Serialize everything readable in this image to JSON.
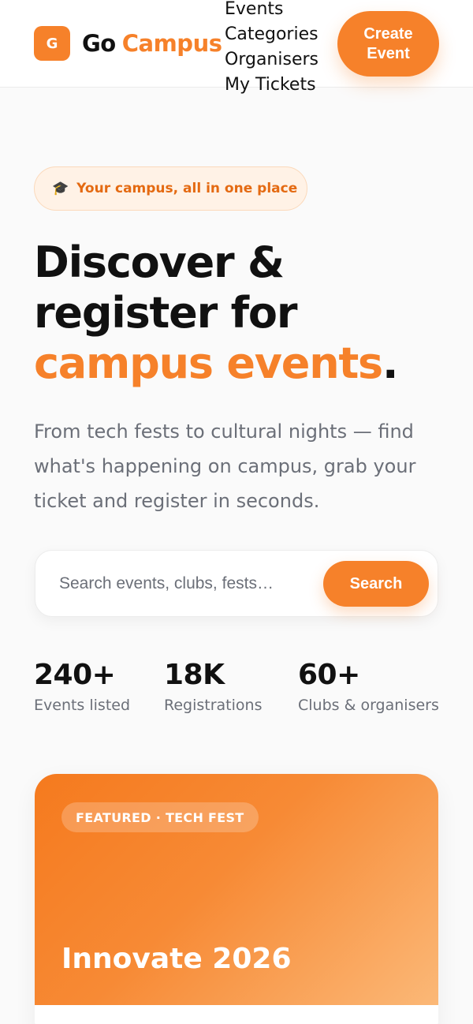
{
  "header": {
    "logo_mark": "G",
    "logo_go": "Go",
    "logo_campus": "Campus",
    "nav": [
      "Events",
      "Categories",
      "Organisers",
      "My Tickets"
    ],
    "create_button": "Create Event"
  },
  "hero": {
    "pill_icon": "graduation-cap-icon",
    "pill_text": "Your campus, all in one place",
    "title_line1": "Discover &",
    "title_line2": "register for",
    "title_accent": "campus events",
    "title_end": ".",
    "subtitle": "From tech fests to cultural nights — find what's happening on campus, grab your ticket and register in seconds."
  },
  "search": {
    "placeholder": "Search events, clubs, fests…",
    "button": "Search"
  },
  "stats": [
    {
      "value": "240+",
      "label": "Events listed"
    },
    {
      "value": "18K",
      "label": "Registrations"
    },
    {
      "value": "60+",
      "label": "Clubs & organisers"
    }
  ],
  "featured": {
    "tag": "FEATURED · TECH FEST",
    "title": "Innovate 2026"
  },
  "colors": {
    "accent": "#f6812a",
    "text": "#111111",
    "muted": "#6b6f78",
    "background": "#fafafa"
  }
}
